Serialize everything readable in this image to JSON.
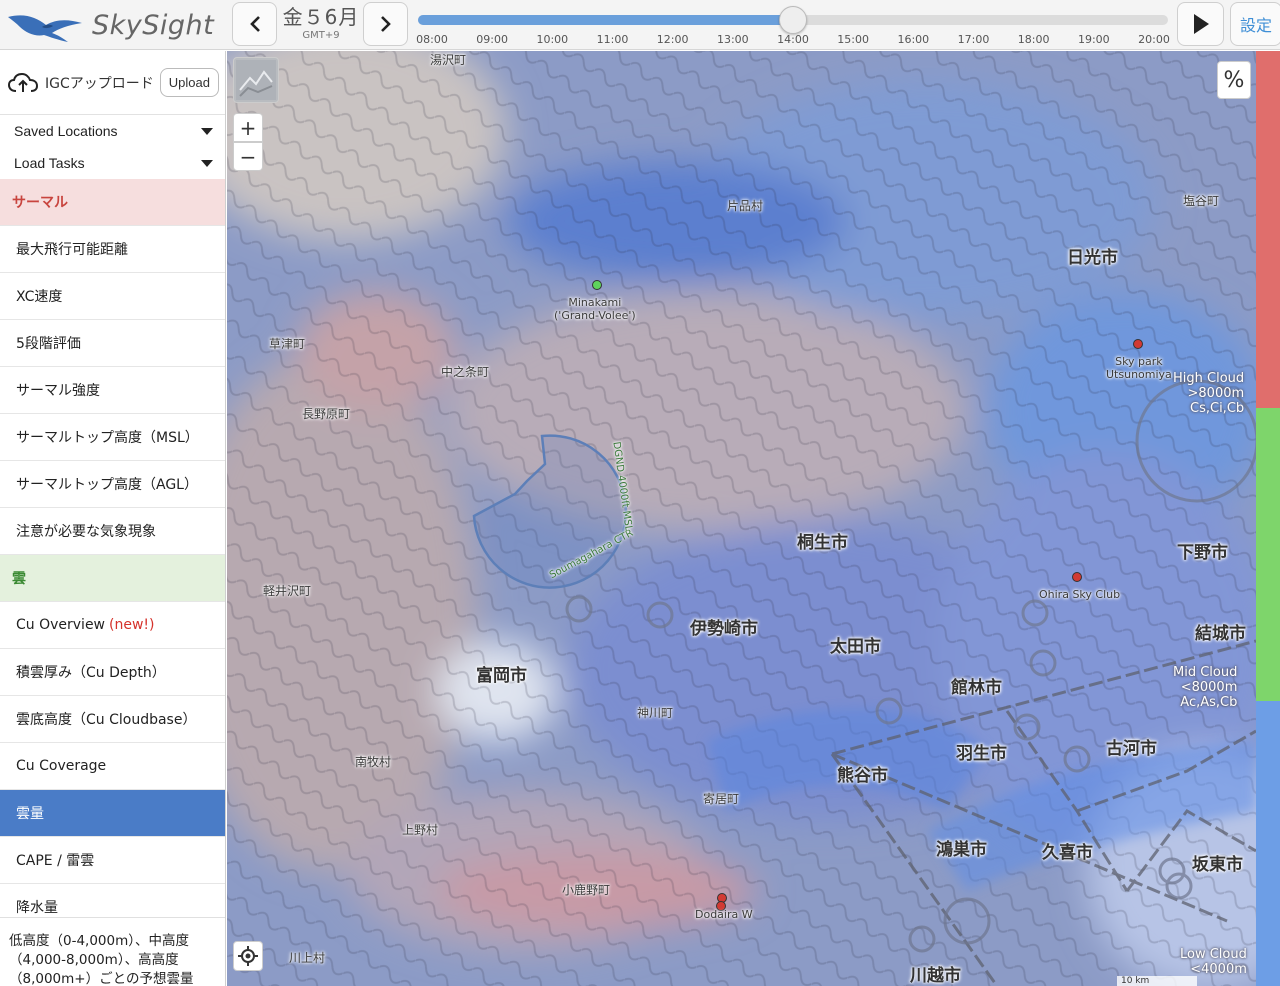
{
  "header": {
    "app_name": "SkySight",
    "date_label": "金５6月",
    "timezone": "GMT+9",
    "time_ticks": [
      "08:00",
      "09:00",
      "10:00",
      "11:00",
      "12:00",
      "13:00",
      "14:00",
      "15:00",
      "16:00",
      "17:00",
      "18:00",
      "19:00",
      "20:00"
    ],
    "selected_time": "14:00",
    "timeline_progress": 0.5,
    "settings_label": "設定"
  },
  "sidebar": {
    "igc_label": "IGCアップロード",
    "upload_label": "Upload",
    "saved_locations": "Saved Locations",
    "load_tasks": "Load Tasks",
    "thermal_category": "サーマル",
    "thermal_items": [
      "最大飛行可能距離",
      "XC速度",
      "5段階評価",
      "サーマル強度",
      "サーマルトップ高度（MSL）",
      "サーマルトップ高度（AGL）",
      "注意が必要な気象現象"
    ],
    "cloud_category": "雲",
    "cu_overview": "Cu Overview",
    "new_tag": "(new!)",
    "cloud_items": [
      "積雲厚み（Cu Depth）",
      "雲底高度（Cu Cloudbase）",
      "Cu Coverage"
    ],
    "selected_item": "雲量",
    "other_items": [
      "CAPE / 雷雲",
      "降水量"
    ],
    "description": "低高度（0-4,000m）、中高度（4,000-8,000m）、高高度（8,000m+）ごとの予想雲量"
  },
  "map": {
    "places_small": [
      "湯沢町",
      "片品村",
      "塩谷町",
      "草津町",
      "中之条町",
      "長野原町",
      "軽井沢町",
      "神川町",
      "南牧村",
      "寄居町",
      "上野村",
      "小鹿野町",
      "川上村"
    ],
    "places_city": [
      "日光市",
      "桐生市",
      "下野市",
      "伊勢崎市",
      "太田市",
      "富岡市",
      "結城市",
      "館林市",
      "羽生市",
      "古河市",
      "熊谷市",
      "鴻巣市",
      "久喜市",
      "坂東市",
      "川越市"
    ],
    "airfields": [
      "Minakami\n('Grand-Volee')",
      "Sky park\nUtsunomiya",
      "Ohira Sky Club",
      "Dodaira W"
    ],
    "ctr_name": "Soumagahara CTR",
    "ctr_limit": "DGND 4000ft MSL",
    "cloud_legend": {
      "high": [
        "High Cloud",
        ">8000m",
        "Cs,Ci,Cb"
      ],
      "mid": [
        "Mid Cloud",
        "<8000m",
        "Ac,As,Cb"
      ],
      "low": [
        "Low Cloud",
        "<4000m"
      ]
    },
    "percent_label": "%",
    "zoom_in": "+",
    "zoom_out": "−",
    "scale_label": "10 km"
  },
  "colors": {
    "accent": "#4a7cc7",
    "thermal_bg": "#f6dede",
    "cloud_bg": "#e4f1dd",
    "high_cloud_bar": "#e06e6c",
    "mid_cloud_bar": "#7ed56b",
    "low_cloud_bar": "#6d9ee6"
  }
}
